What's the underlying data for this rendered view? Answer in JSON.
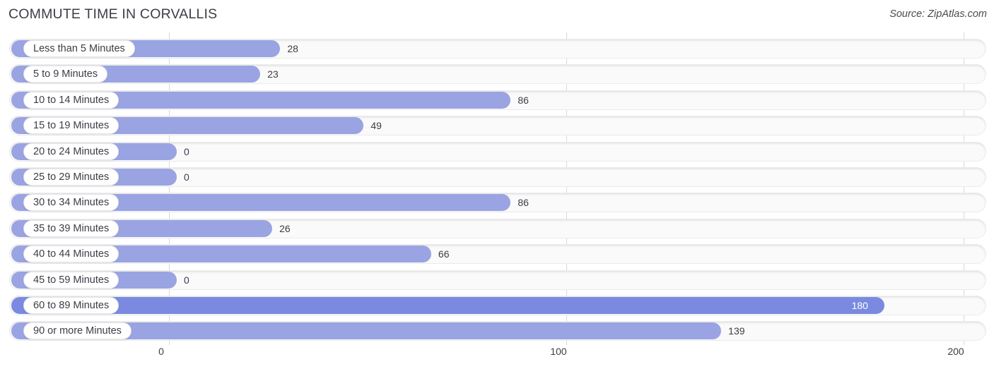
{
  "header": {
    "title": "COMMUTE TIME IN CORVALLIS",
    "source": "Source: ZipAtlas.com"
  },
  "chart_data": {
    "type": "bar",
    "orientation": "horizontal",
    "title": "COMMUTE TIME IN CORVALLIS",
    "xlabel": "",
    "ylabel": "",
    "xlim": [
      0,
      200
    ],
    "xticks": [
      0,
      100,
      200
    ],
    "xtick_labels": [
      "0",
      "100",
      "200"
    ],
    "grid": true,
    "legend": false,
    "categories": [
      "Less than 5 Minutes",
      "5 to 9 Minutes",
      "10 to 14 Minutes",
      "15 to 19 Minutes",
      "20 to 24 Minutes",
      "25 to 29 Minutes",
      "30 to 34 Minutes",
      "35 to 39 Minutes",
      "40 to 44 Minutes",
      "45 to 59 Minutes",
      "60 to 89 Minutes",
      "90 or more Minutes"
    ],
    "values": [
      28,
      23,
      86,
      49,
      0,
      0,
      86,
      26,
      66,
      0,
      180,
      139
    ],
    "value_labels": [
      "28",
      "23",
      "86",
      "49",
      "0",
      "0",
      "86",
      "26",
      "66",
      "0",
      "180",
      "139"
    ],
    "bar_color": "#9aa4e2",
    "bar_color_strong": "#7b8ae0",
    "track_color": "#fafafa"
  }
}
